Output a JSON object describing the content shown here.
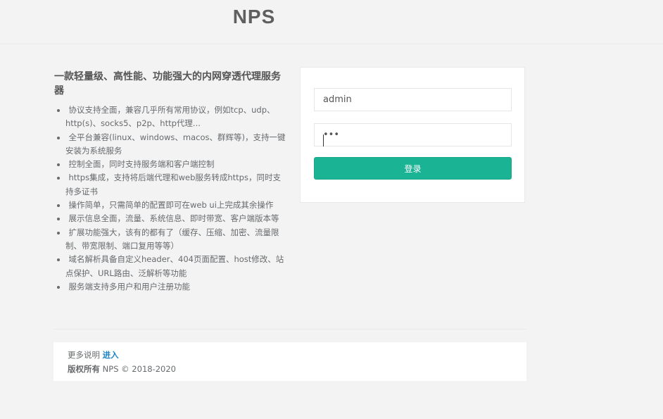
{
  "header": {
    "brand": "NPS"
  },
  "intro": {
    "title": "一款轻量级、高性能、功能强大的内网穿透代理服务器",
    "features": [
      "协议支持全面，兼容几乎所有常用协议，例如tcp、udp、http(s)、socks5、p2p、http代理...",
      "全平台兼容(linux、windows、macos、群辉等)，支持一键安装为系统服务",
      "控制全面，同时支持服务端和客户端控制",
      "https集成，支持将后端代理和web服务转成https，同时支持多证书",
      "操作简单，只需简单的配置即可在web ui上完成其余操作",
      "展示信息全面，流量、系统信息、即时带宽、客户端版本等",
      "扩展功能强大，该有的都有了（缓存、压缩、加密、流量限制、带宽限制、端口复用等等）",
      "域名解析具备自定义header、404页面配置、host修改、站点保护、URL路由、泛解析等功能",
      "服务端支持多用户和用户注册功能"
    ]
  },
  "login": {
    "username_value": "admin",
    "password_value": "•••",
    "submit_label": "登录"
  },
  "footer": {
    "more_label": "更多说明",
    "more_link": "进入",
    "copyright_label": "版权所有",
    "copyright_text": "NPS © 2018-2020"
  },
  "colors": {
    "accent": "#1ab394",
    "link": "#1c84c6",
    "background": "#f3f3f4"
  }
}
